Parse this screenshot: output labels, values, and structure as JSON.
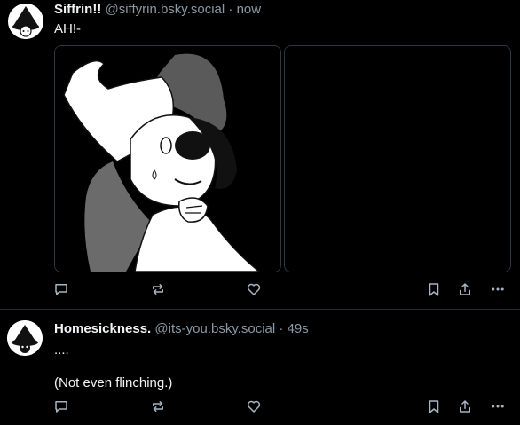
{
  "posts": [
    {
      "author": {
        "display_name": "Siffrin!!",
        "handle": "@siffyrin.bsky.social"
      },
      "separator": "·",
      "time": "now",
      "text": "AH!-",
      "media": [
        {
          "icon": "illustration-image"
        },
        {
          "icon": "black-image"
        }
      ],
      "actions": [
        "reply-icon",
        "repost-icon",
        "like-icon",
        "bookmark-icon",
        "share-icon",
        "more-icon"
      ]
    },
    {
      "author": {
        "display_name": "Homesickness.",
        "handle": "@its-you.bsky.social"
      },
      "separator": "·",
      "time": "49s",
      "text_lines": [
        "....",
        "(Not even flinching.)"
      ],
      "actions": [
        "reply-icon",
        "repost-icon",
        "like-icon",
        "bookmark-icon",
        "share-icon",
        "more-icon"
      ]
    }
  ],
  "colors": {
    "background": "#000000",
    "text": "#f1f3f5",
    "muted": "#8b98a5",
    "border": "#242b33",
    "icon": "#a7b4c1"
  }
}
